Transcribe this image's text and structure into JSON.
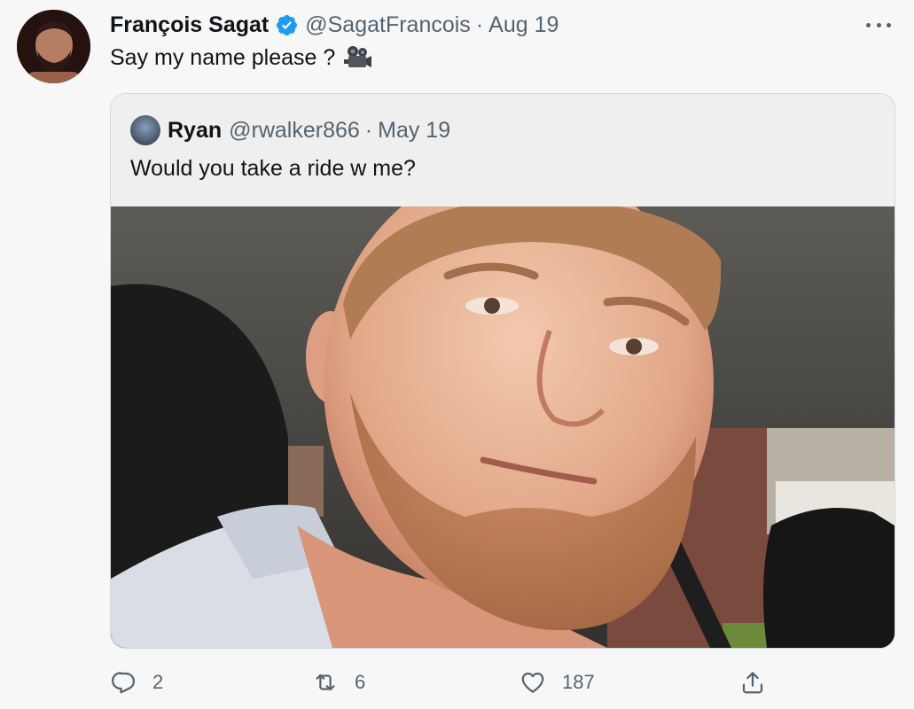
{
  "author": {
    "name": "François Sagat",
    "handle": "@SagatFrancois",
    "separator": "·",
    "date": "Aug 19",
    "verified": true
  },
  "tweet": {
    "text": "Say my name please ?",
    "emoji_icon": "movie-camera-icon"
  },
  "quoted_tweet": {
    "name": "Ryan",
    "handle": "@rwalker866",
    "separator": "·",
    "date": "May 19",
    "text": "Would you take a ride w me?",
    "image": "selfie-in-car-photo"
  },
  "actions": {
    "reply_count": "2",
    "retweet_count": "6",
    "like_count": "187"
  },
  "colors": {
    "verified_blue": "#1d9bf0",
    "secondary_text": "#536471",
    "primary_text": "#0f1419",
    "border": "#cfd9de",
    "background": "#f7f7f7"
  }
}
